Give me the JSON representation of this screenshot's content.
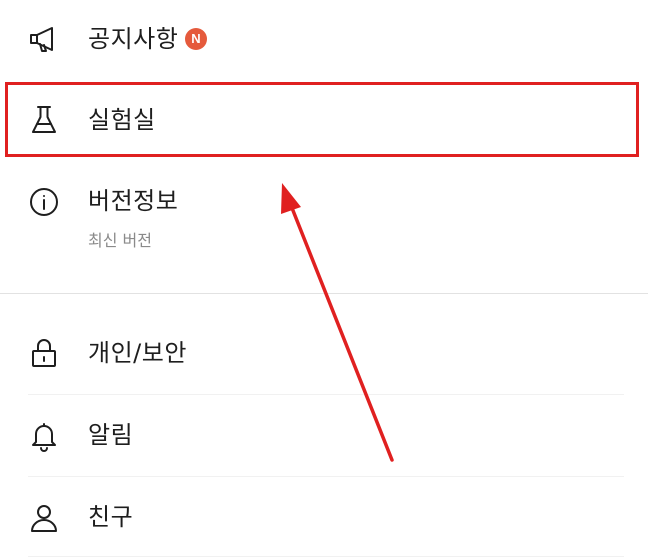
{
  "menu": {
    "notice": {
      "label": "공지사항",
      "badge": "N",
      "icon": "megaphone-icon"
    },
    "lab": {
      "label": "실험실",
      "icon": "flask-icon"
    },
    "version": {
      "label": "버전정보",
      "sublabel": "최신 버전",
      "icon": "info-icon"
    },
    "privacy": {
      "label": "개인/보안",
      "icon": "lock-icon"
    },
    "alarm": {
      "label": "알림",
      "icon": "bell-icon"
    },
    "friends": {
      "label": "친구",
      "icon": "person-icon"
    }
  },
  "colors": {
    "badge": "#e55a3c",
    "highlight": "#e02020",
    "text": "#1e1e1e",
    "subtext": "#8a8a8a"
  }
}
